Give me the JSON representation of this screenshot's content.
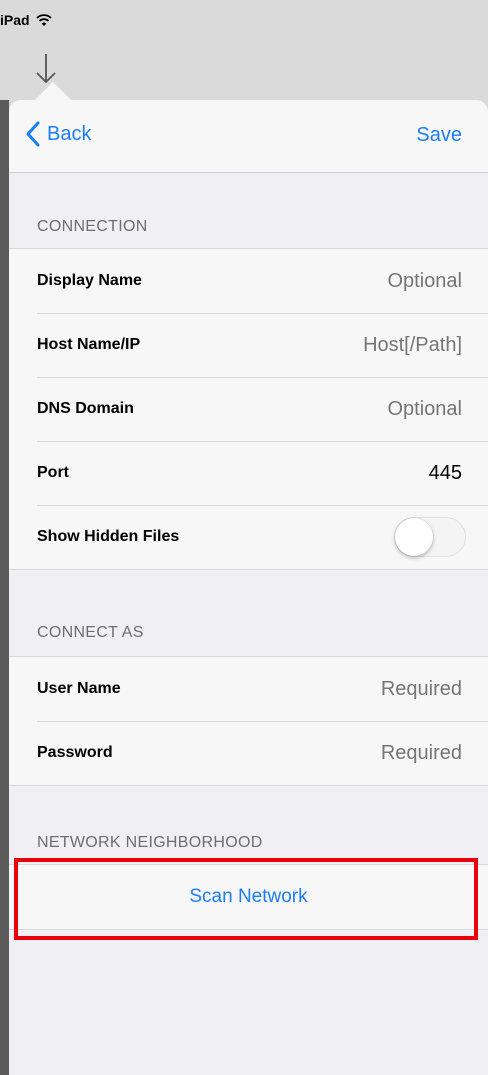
{
  "status_bar": {
    "device": "iPad",
    "wifi_icon": "wifi-icon"
  },
  "nav": {
    "back_label": "Back",
    "save_label": "Save"
  },
  "connection": {
    "header": "CONNECTION",
    "rows": [
      {
        "label": "Display Name",
        "value": "",
        "placeholder": "Optional"
      },
      {
        "label": "Host Name/IP",
        "value": "",
        "placeholder": "Host[/Path]"
      },
      {
        "label": "DNS Domain",
        "value": "",
        "placeholder": "Optional"
      },
      {
        "label": "Port",
        "value": "445",
        "placeholder": ""
      }
    ],
    "toggle": {
      "label": "Show Hidden Files",
      "on": false
    }
  },
  "connect_as": {
    "header": "CONNECT AS",
    "rows": [
      {
        "label": "User Name",
        "value": "",
        "placeholder": "Required"
      },
      {
        "label": "Password",
        "value": "",
        "placeholder": "Required"
      }
    ]
  },
  "network": {
    "header": "NETWORK NEIGHBORHOOD",
    "scan_label": "Scan Network"
  },
  "colors": {
    "accent": "#1c7ef6",
    "highlight": "#e8000b"
  }
}
